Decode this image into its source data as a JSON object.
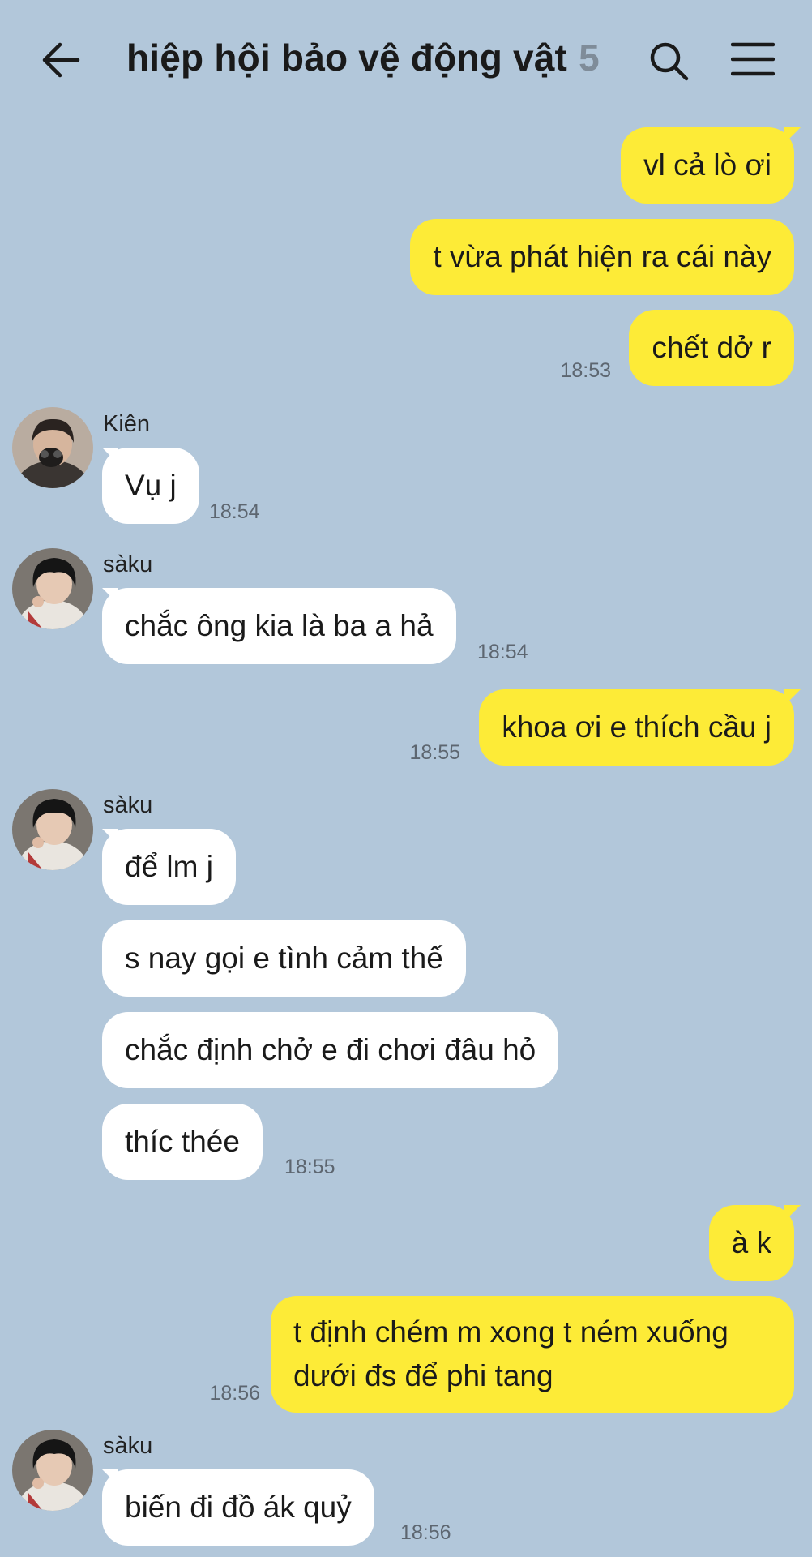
{
  "header": {
    "title": "hiệp hội bảo vệ động vật",
    "member_count": "5",
    "back_icon": "arrow-left-icon",
    "search_icon": "search-icon",
    "menu_icon": "hamburger-menu-icon"
  },
  "colors": {
    "background": "#b2c7da",
    "outgoing_bubble": "#fdeb37",
    "incoming_bubble": "#ffffff"
  },
  "messages": [
    {
      "direction": "out",
      "text": "vl cả lò ơi"
    },
    {
      "direction": "out",
      "text": "t vừa phát hiện ra cái này"
    },
    {
      "direction": "out",
      "text": "chết dở r",
      "time": "18:53"
    },
    {
      "direction": "in",
      "sender": "Kiên",
      "text": "Vụ j",
      "time": "18:54"
    },
    {
      "direction": "in",
      "sender": "sàku",
      "text": "chắc ông kia là ba a hả",
      "time": "18:54"
    },
    {
      "direction": "out",
      "text": "khoa ơi e thích cầu j",
      "time": "18:55"
    },
    {
      "direction": "in",
      "sender": "sàku",
      "text": "để lm j"
    },
    {
      "direction": "in",
      "text": "s nay gọi e tình cảm thế"
    },
    {
      "direction": "in",
      "text": "chắc định chở e đi chơi đâu hỏ"
    },
    {
      "direction": "in",
      "text": "thíc thée",
      "time": "18:55"
    },
    {
      "direction": "out",
      "text": "à k"
    },
    {
      "direction": "out",
      "text": "t định chém m xong t ném xuống dưới đs để phi tang",
      "time": "18:56"
    },
    {
      "direction": "in",
      "sender": "sàku",
      "text": "biến đi đồ ák quỷ",
      "time": "18:56"
    }
  ]
}
